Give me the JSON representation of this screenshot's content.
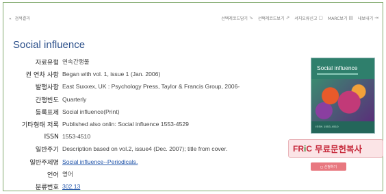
{
  "topbar": {
    "back_label": "검색결과",
    "actions": [
      {
        "label": "선택레코드담기",
        "icon": "cart-icon",
        "glyph": "⇘"
      },
      {
        "label": "선택레코드보기",
        "icon": "view-icon",
        "glyph": "⇗"
      },
      {
        "label": "서지오류신고",
        "icon": "report-icon",
        "glyph": "▢"
      },
      {
        "label": "MARC보기",
        "icon": "marc-icon",
        "glyph": "▤"
      },
      {
        "label": "내보내기",
        "icon": "export-icon",
        "glyph": "⇥"
      }
    ]
  },
  "record": {
    "title": "Social influence",
    "fields": [
      {
        "label": "자료유형",
        "value": "연속간행물"
      },
      {
        "label": "권 연차 사항",
        "value": "Began with vol. 1, issue 1 (Jan. 2006)"
      },
      {
        "label": "발행사항",
        "value": "East Suxxex, UK : Psychology Press, Taylor & Francis Group, 2006-"
      },
      {
        "label": "간행빈도",
        "value": "Quarterly"
      },
      {
        "label": "등록표제",
        "value": "Social influence(Print)"
      },
      {
        "label": "기타형태 저록",
        "value": "Published also onlin: Social influence 1553-4529"
      },
      {
        "label": "ISSN",
        "value": "1553-4510"
      },
      {
        "label": "일반주기",
        "value": "Description based on vol.2, issue4 (Dec. 2007); title from cover."
      },
      {
        "label": "일반주제명",
        "value": "Social influence--Periodicals.",
        "link": true
      },
      {
        "label": "언어",
        "value": "영어"
      },
      {
        "label": "분류번호",
        "value": "302.13",
        "link": true
      }
    ]
  },
  "cover": {
    "title": "Social influence",
    "footer": "ISSN 1553-4510"
  },
  "fric": {
    "logo_main": "FR",
    "logo_i": "i",
    "logo_c": "C",
    "label": "무료문헌복사"
  },
  "small_button": {
    "label": "◻ 신청하기"
  },
  "colors": {
    "accent": "#2b4f8a",
    "fric_red": "#c62a3c",
    "border_green": "#7fa86b"
  }
}
